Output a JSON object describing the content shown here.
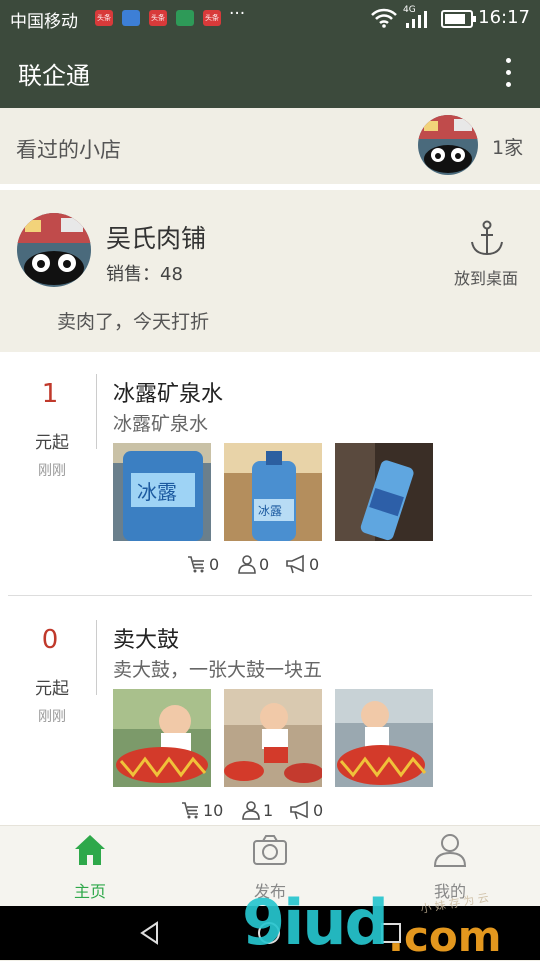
{
  "status_bar": {
    "carrier": "中国移动",
    "notification_badges": [
      "头条",
      "",
      "头条",
      "",
      "头条"
    ],
    "more": "···",
    "network": "4G",
    "time": "16:17"
  },
  "app_bar": {
    "title": "联企通"
  },
  "viewed_shops": {
    "label": "看过的小店",
    "count": "1家"
  },
  "shop": {
    "name": "吴氏肉铺",
    "sales": "销售：48",
    "pin_label": "放到桌面",
    "description": "卖肉了，今天打折"
  },
  "products": [
    {
      "price": "1",
      "unit": "元起",
      "time": "刚刚",
      "name": "冰露矿泉水",
      "subtitle": "冰露矿泉水",
      "cart": "0",
      "users": "0",
      "shares": "0"
    },
    {
      "price": "0",
      "unit": "元起",
      "time": "刚刚",
      "name": "卖大鼓",
      "subtitle": "卖大鼓，一张大鼓一块五",
      "cart": "10",
      "users": "1",
      "shares": "0"
    }
  ],
  "tabs": [
    {
      "label": "主页",
      "icon": "home-icon",
      "active": true
    },
    {
      "label": "发布",
      "icon": "camera-icon",
      "active": false
    },
    {
      "label": "我的",
      "icon": "person-icon",
      "active": false
    }
  ],
  "watermark": {
    "text": "9iud",
    "domain": ".com",
    "caption": "小 妹 存 为 云"
  },
  "colors": {
    "header": "#3c4a3c",
    "price": "#c0392b",
    "active_tab": "#2ea84a",
    "background": "#f1efe6"
  }
}
